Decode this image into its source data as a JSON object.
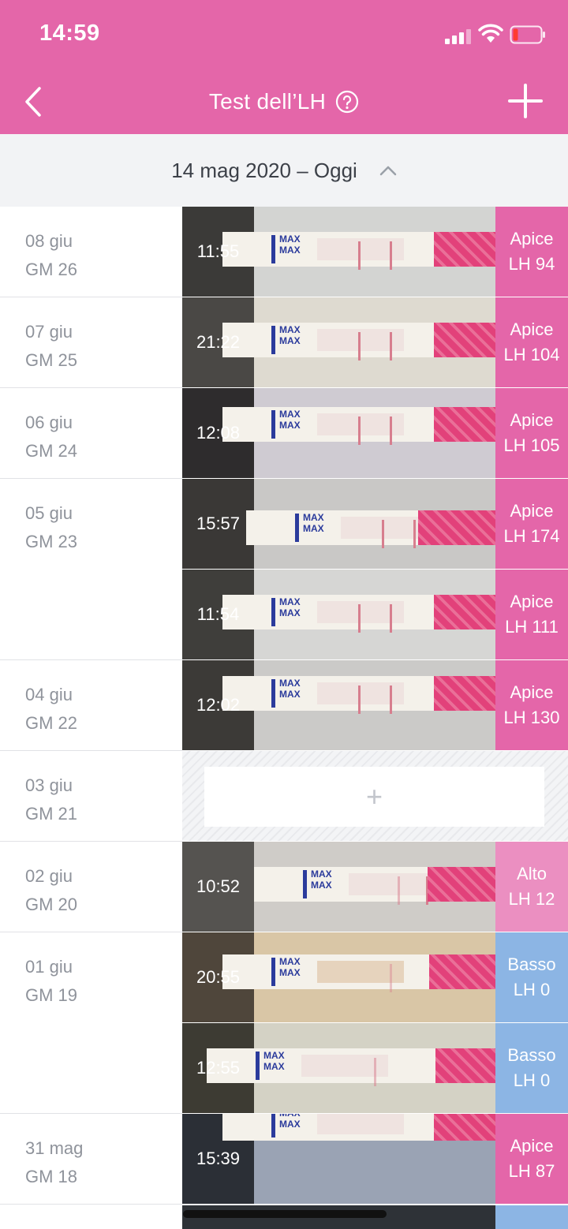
{
  "status_bar": {
    "time": "14:59"
  },
  "nav": {
    "title": "Test dell’LH"
  },
  "date_range": {
    "label": "14 mag 2020 – Oggi"
  },
  "entries": [
    {
      "date": "08 giu",
      "cycle_day": "GM 26",
      "time": "11:55",
      "result": "Apice",
      "lh": "LH 94"
    },
    {
      "date": "07 giu",
      "cycle_day": "GM 25",
      "time": "21:22",
      "result": "Apice",
      "lh": "LH 104"
    },
    {
      "date": "06 giu",
      "cycle_day": "GM 24",
      "time": "12:08",
      "result": "Apice",
      "lh": "LH 105"
    },
    {
      "date": "05 giu",
      "cycle_day": "GM 23",
      "time": "15:57",
      "result": "Apice",
      "lh": "LH 174"
    },
    {
      "date": "",
      "cycle_day": "",
      "time": "11:54",
      "result": "Apice",
      "lh": "LH 111"
    },
    {
      "date": "04 giu",
      "cycle_day": "GM 22",
      "time": "12:02",
      "result": "Apice",
      "lh": "LH 130"
    },
    {
      "date": "03 giu",
      "cycle_day": "GM 21",
      "time": "",
      "result": "",
      "lh": ""
    },
    {
      "date": "02 giu",
      "cycle_day": "GM 20",
      "time": "10:52",
      "result": "Alto",
      "lh": "LH 12"
    },
    {
      "date": "01 giu",
      "cycle_day": "GM 19",
      "time": "20:55",
      "result": "Basso",
      "lh": "LH 0"
    },
    {
      "date": "",
      "cycle_day": "",
      "time": "12:55",
      "result": "Basso",
      "lh": "LH 0"
    },
    {
      "date": "31 mag",
      "cycle_day": "GM 18",
      "time": "15:39",
      "result": "Apice",
      "lh": "LH 87"
    }
  ],
  "empty_add_symbol": "+",
  "strip_text": "MAX",
  "colors": {
    "brand_pink": "#e466a9",
    "alto_pink": "#eb8fc1",
    "basso_blue": "#8cb5e4",
    "header_bg": "#f2f3f5"
  }
}
